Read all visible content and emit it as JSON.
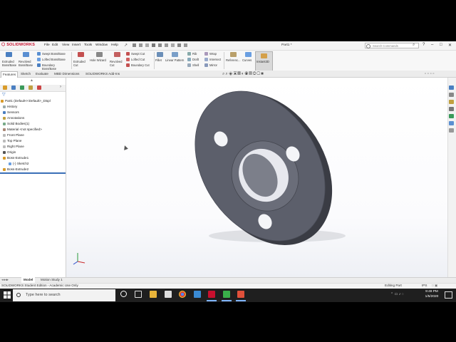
{
  "app": {
    "logo_text": "SOLIDWORKS",
    "document_title": "Part1 *",
    "menu": [
      "File",
      "Edit",
      "View",
      "Insert",
      "Tools",
      "Window",
      "Help"
    ],
    "search_placeholder": "Search Commands",
    "brand_color": "#c8102e"
  },
  "commands": {
    "extruded_boss": "Extruded Boss/Base",
    "revolved_boss": "Revolved Boss/Base",
    "swept_boss": "Swept Boss/Base",
    "lofted_boss": "Lofted Boss/Base",
    "boundary_boss": "Boundary Boss/Base",
    "extruded_cut": "Extruded Cut",
    "hole_wizard": "Hole Wizard",
    "revolved_cut": "Revolved Cut",
    "swept_cut": "Swept Cut",
    "lofted_cut": "Lofted Cut",
    "boundary_cut": "Boundary Cut",
    "fillet": "Fillet",
    "linear_pattern": "Linear Pattern",
    "rib": "Rib",
    "draft": "Draft",
    "shell": "Shell",
    "wrap": "Wrap",
    "intersect": "Intersect",
    "mirror": "Mirror",
    "reference": "Referenc...",
    "curves": "Curves",
    "instant3d": "Instant3D"
  },
  "tabs": [
    "Features",
    "Sketch",
    "Evaluate",
    "MBD Dimensions",
    "SOLIDWORKS Add-Ins"
  ],
  "tree": {
    "root": "Part1  (Default<<Default>_Displ",
    "items": [
      "History",
      "Sensors",
      "Annotations",
      "Solid Bodies(1)",
      "Material <not specified>",
      "Front Plane",
      "Top Plane",
      "Right Plane",
      "Origin",
      "Boss-Extrude1",
      "(-) Sketch2",
      "Boss-Extrude2"
    ]
  },
  "model_tabs": [
    "Model",
    "Motion Study 1"
  ],
  "status": {
    "left": "SOLIDWORKS Student Edition - Academic Use Only",
    "mode": "Editing Part",
    "units": "IPS"
  },
  "taskbar": {
    "search_placeholder": "Type here to search",
    "time": "9:49 PM",
    "date": "1/5/2020"
  },
  "colors": {
    "part_face": "#5c5f6b",
    "part_edge": "#3a3c44",
    "taskbar": "#1f1f1f",
    "selection": "#3a6fb7"
  }
}
